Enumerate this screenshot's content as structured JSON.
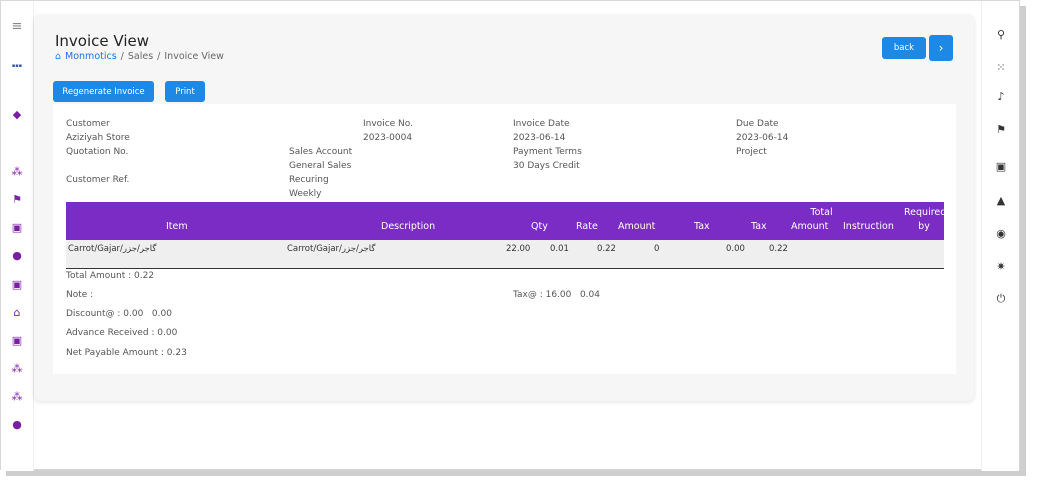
{
  "header": {
    "title": "Invoice View",
    "breadcrumb": [
      "Monmotics",
      "Sales",
      "Invoice View"
    ],
    "back_label": "back",
    "next_label": "›"
  },
  "actions": {
    "regenerate_label": "Regenerate Invoice",
    "print_label": "Print"
  },
  "invoice": {
    "customer_label": "Customer",
    "customer_value": "Aziziyah Store",
    "invoice_no_label": "Invoice No.",
    "invoice_no_value": "2023-0004",
    "invoice_date_label": "Invoice Date",
    "invoice_date_value": "2023-06-14",
    "due_date_label": "Due Date",
    "due_date_value": "2023-06-14",
    "quotation_label": "Quotation No.",
    "sales_account_label": "Sales Account",
    "sales_account_value": "General Sales",
    "payment_terms_label": "Payment Terms",
    "payment_terms_value": "30 Days Credit",
    "project_label": "Project",
    "customer_ref_label": "Customer Ref.",
    "recurring_label": "Recuring",
    "recurring_value": "Weekly"
  },
  "table": {
    "headers": {
      "item": "Item",
      "description": "Description",
      "qty": "Qty",
      "rate": "Rate",
      "amount": "Amount",
      "tax1": "Tax",
      "tax2": "Tax",
      "total_line1": "Total",
      "total_line2": "Amount",
      "instruction": "Instruction",
      "required_line1": "Required",
      "required_line2": "by"
    },
    "rows": [
      {
        "item": "Carrot/Gajar/گاجر/جزر",
        "description": "Carrot/Gajar/گاجر/جزر",
        "qty": "22.00",
        "rate": "0.01",
        "amount": "0.22",
        "tax1": "0",
        "tax2": "0.00",
        "total": "0.22"
      }
    ]
  },
  "summary": {
    "total_amount": "Total Amount : 0.22",
    "note": "Note :",
    "tax": "Tax@ : 16.00   0.04",
    "discount": "Discount@ : 0.00   0.00",
    "advance": "Advance Received : 0.00",
    "net_payable": "Net Payable Amount : 0.23"
  },
  "colors": {
    "accent": "#7a2cc4",
    "button": "#1e88e5"
  }
}
